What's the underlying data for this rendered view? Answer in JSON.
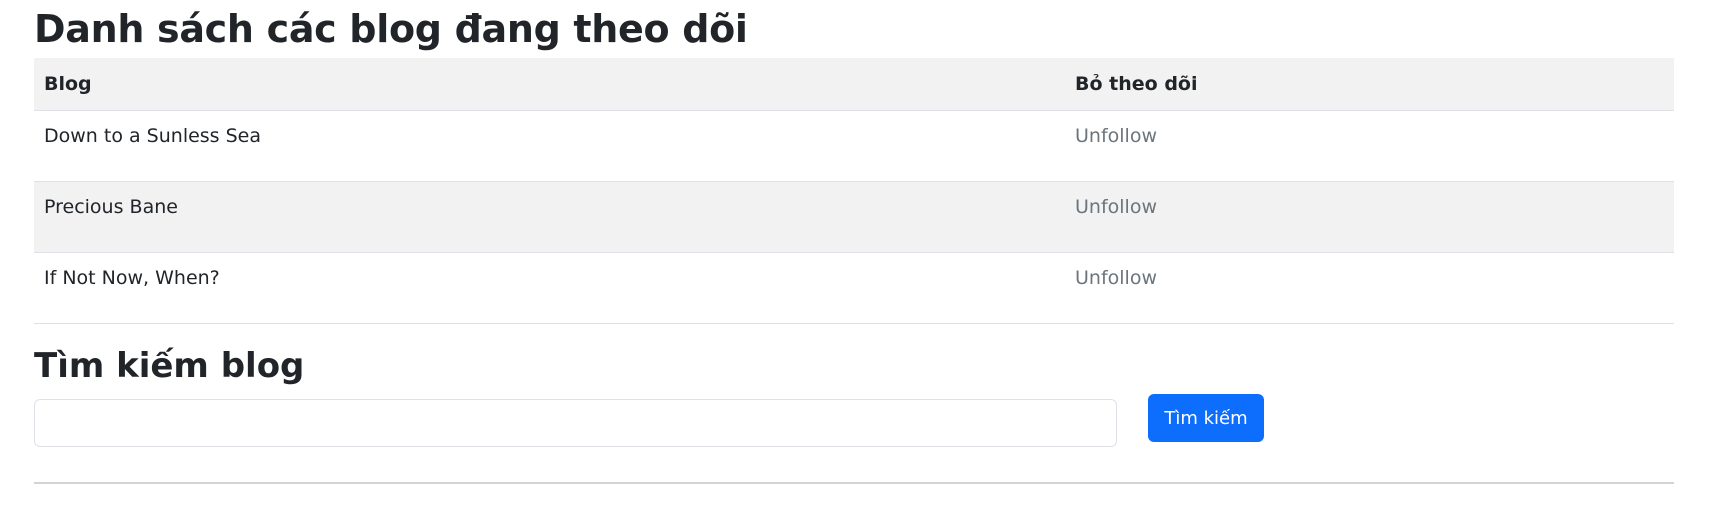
{
  "page_title": "Danh sách các blog đang theo dõi",
  "table": {
    "headers": {
      "blog": "Blog",
      "unfollow": "Bỏ theo dõi"
    },
    "rows": [
      {
        "blog": "Down to a Sunless Sea",
        "action": "Unfollow"
      },
      {
        "blog": "Precious Bane",
        "action": "Unfollow"
      },
      {
        "blog": "If Not Now, When?",
        "action": "Unfollow"
      }
    ]
  },
  "search": {
    "title": "Tìm kiếm blog",
    "input_value": "",
    "button_label": "Tìm kiếm"
  },
  "colors": {
    "primary_button": "#0d6efd",
    "stripe": "#f2f2f2",
    "muted_link": "#6c757d"
  }
}
